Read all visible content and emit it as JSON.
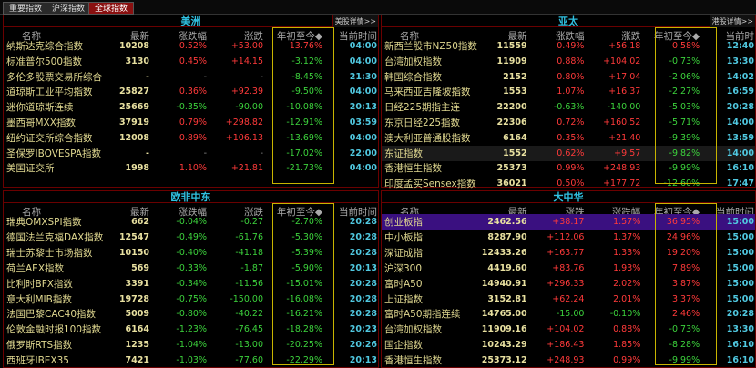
{
  "tabs": [
    "重要指数",
    "沪深指数",
    "全球指数"
  ],
  "active_tab": 2,
  "panels": [
    {
      "id": "americas",
      "title": "美洲",
      "link": "美股详情>>",
      "headers": [
        "名称",
        "最新",
        "涨跌幅",
        "涨跌",
        "年初至今◆",
        "当前时间"
      ],
      "rows": [
        [
          "纳斯达克综合指数",
          "10208",
          "0.52%",
          "+53.00",
          "13.76%",
          "04:00"
        ],
        [
          "标准普尔500指数",
          "3130",
          "0.45%",
          "+14.15",
          "-3.12%",
          "04:00"
        ],
        [
          "多伦多股票交易所综合",
          "-",
          "-",
          "-",
          "-8.45%",
          "21:30"
        ],
        [
          "道琼斯工业平均指数",
          "25827",
          "0.36%",
          "+92.39",
          "-9.50%",
          "04:00"
        ],
        [
          "迷你道琼斯连续",
          "25669",
          "-0.35%",
          "-90.00",
          "-10.08%",
          "20:13"
        ],
        [
          "墨西哥MXX指数",
          "37919",
          "0.79%",
          "+298.82",
          "-12.91%",
          "03:59"
        ],
        [
          "纽约证交所综合指数",
          "12008",
          "0.89%",
          "+106.13",
          "-13.69%",
          "04:00"
        ],
        [
          "圣保罗IBOVESPA指数",
          "-",
          "-",
          "-",
          "-17.02%",
          "22:00"
        ],
        [
          "美国证交所",
          "1998",
          "1.10%",
          "+21.81",
          "-21.73%",
          "04:00"
        ]
      ]
    },
    {
      "id": "asia-pacific",
      "title": "亚太",
      "link": "港股详情>>",
      "headers": [
        "名称",
        "最新",
        "涨跌幅",
        "涨跌",
        "年初至今◆",
        "当前时"
      ],
      "rows": [
        [
          "新西兰股市NZ50指数",
          "11559",
          "0.49%",
          "+56.18",
          "0.58%",
          "12:40"
        ],
        [
          "台湾加权指数",
          "11909",
          "0.88%",
          "+104.02",
          "-0.73%",
          "13:30"
        ],
        [
          "韩国综合指数",
          "2152",
          "0.80%",
          "+17.04",
          "-2.06%",
          "14:02"
        ],
        [
          "马来西亚吉隆坡指数",
          "1553",
          "1.07%",
          "+16.37",
          "-2.27%",
          "16:59"
        ],
        [
          "日经225期指主连",
          "22200",
          "-0.63%",
          "-140.00",
          "-5.03%",
          "20:28"
        ],
        [
          "东京日经225指数",
          "22306",
          "0.72%",
          "+160.52",
          "-5.71%",
          "14:00"
        ],
        [
          "澳大利亚普通股指数",
          "6164",
          "0.35%",
          "+21.40",
          "-9.39%",
          "13:59"
        ],
        [
          "东证指数",
          "1552",
          "0.62%",
          "+9.57",
          "-9.82%",
          "14:00"
        ],
        [
          "香港恒生指数",
          "25373",
          "0.99%",
          "+248.93",
          "-9.99%",
          "16:10"
        ],
        [
          "印度孟买Sensex指数",
          "36021",
          "0.50%",
          "+177.72",
          "-12.60%",
          "17:47"
        ]
      ]
    },
    {
      "id": "europe-africa-mideast",
      "title": "欧非中东",
      "link": "",
      "headers": [
        "名称",
        "最新",
        "涨跌幅",
        "涨跌",
        "年初至今◆",
        "当前时间"
      ],
      "rows": [
        [
          "瑞典OMXSPI指数",
          "662",
          "-0.04%",
          "-0.27",
          "-2.70%",
          "20:28"
        ],
        [
          "德国法兰克福DAX指数",
          "12547",
          "-0.49%",
          "-61.76",
          "-5.30%",
          "20:28"
        ],
        [
          "瑞士苏黎士市场指数",
          "10150",
          "-0.40%",
          "-41.18",
          "-5.39%",
          "20:28"
        ],
        [
          "荷兰AEX指数",
          "569",
          "-0.33%",
          "-1.87",
          "-5.90%",
          "20:13"
        ],
        [
          "比利时BFX指数",
          "3391",
          "-0.34%",
          "-11.56",
          "-15.01%",
          "20:28"
        ],
        [
          "意大利MIB指数",
          "19728",
          "-0.75%",
          "-150.00",
          "-16.08%",
          "20:28"
        ],
        [
          "法国巴黎CAC40指数",
          "5009",
          "-0.80%",
          "-40.22",
          "-16.21%",
          "20:28"
        ],
        [
          "伦敦金融时报100指数",
          "6164",
          "-1.23%",
          "-76.45",
          "-18.28%",
          "20:23"
        ],
        [
          "俄罗斯RTS指数",
          "1235",
          "-1.04%",
          "-13.00",
          "-20.25%",
          "20:26"
        ],
        [
          "西班牙IBEX35",
          "7421",
          "-1.03%",
          "-77.60",
          "-22.29%",
          "20:13"
        ]
      ]
    },
    {
      "id": "greater-china",
      "title": "大中华",
      "link": "",
      "headers": [
        "名称",
        "最新",
        "涨跌",
        "涨跌幅",
        "年初至今◆",
        "当前时间"
      ],
      "rows": [
        [
          "创业板指",
          "2462.56",
          "+38.17",
          "1.57%",
          "36.95%",
          "15:00"
        ],
        [
          "中小板指",
          "8287.90",
          "+112.06",
          "1.37%",
          "24.96%",
          "15:00"
        ],
        [
          "深证成指",
          "12433.26",
          "+163.77",
          "1.33%",
          "19.20%",
          "15:00"
        ],
        [
          "沪深300",
          "4419.60",
          "+83.76",
          "1.93%",
          "7.89%",
          "15:00"
        ],
        [
          "富时A50",
          "14940.91",
          "+296.33",
          "2.02%",
          "3.87%",
          "15:00"
        ],
        [
          "上证指数",
          "3152.81",
          "+62.24",
          "2.01%",
          "3.37%",
          "15:00"
        ],
        [
          "富时A50期指连续",
          "14765.00",
          "-15.00",
          "-0.10%",
          "2.46%",
          "20:28"
        ],
        [
          "台湾加权指数",
          "11909.16",
          "+104.02",
          "0.88%",
          "-0.73%",
          "13:30"
        ],
        [
          "国企指数",
          "10243.29",
          "+186.43",
          "1.85%",
          "-8.28%",
          "16:10"
        ],
        [
          "香港恒生指数",
          "25373.12",
          "+248.93",
          "0.99%",
          "-9.99%",
          "16:10"
        ]
      ]
    }
  ],
  "colors": {
    "up": "#ff3a3a",
    "down": "#3cd23c",
    "time": "#50c8e0",
    "highlight": "#c8b400",
    "selected_row": "#3a1080"
  }
}
